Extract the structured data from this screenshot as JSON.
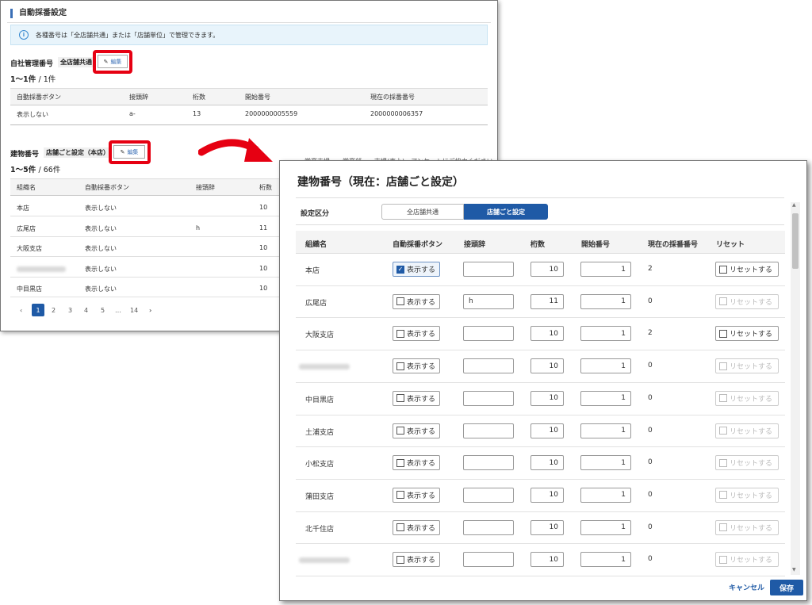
{
  "background": {
    "section_title": "自動採番設定",
    "info_text": "各種番号は「全店舗共通」または「店舗単位」で管理できます。",
    "own_number": {
      "label": "自社管理番号",
      "tag": "全店舗共通",
      "edit_label": "編集",
      "count": "1〜1件",
      "count_total": "/ 1件",
      "headers": [
        "自動採番ボタン",
        "接頭辞",
        "桁数",
        "開始番号",
        "現在の採番番号"
      ],
      "row": [
        "表示しない",
        "a-",
        "13",
        "2000000005559",
        "2000000006357"
      ]
    },
    "building_number": {
      "label": "建物番号",
      "tag": "店舗ごと設定（本店）",
      "edit_label": "編集",
      "count": "1〜5件",
      "count_total": "/ 66件",
      "headers": [
        "組織名",
        "自動採番ボタン",
        "接頭辞",
        "桁数"
      ],
      "rows": [
        {
          "org": "本店",
          "btn": "表示しない",
          "prefix": "",
          "digits": "10"
        },
        {
          "org": "広尾店",
          "btn": "表示しない",
          "prefix": "h",
          "digits": "11"
        },
        {
          "org": "大阪支店",
          "btn": "表示しない",
          "prefix": "",
          "digits": "10"
        },
        {
          "org": "",
          "btn": "表示しない",
          "prefix": "",
          "digits": "10"
        },
        {
          "org": "中目黒店",
          "btn": "表示しない",
          "prefix": "",
          "digits": "10"
        }
      ]
    },
    "pagination": {
      "prev": "‹",
      "pages": [
        "1",
        "2",
        "3",
        "4",
        "5",
        "…",
        "14"
      ],
      "next": "›",
      "active": "1"
    }
  },
  "behind_modal_bar": "営業支援　　営業部　　市場(売上)　アンケートにご協力ください",
  "modal": {
    "title": "建物番号（現在：店舗ごと設定）",
    "setting_label": "設定区分",
    "seg_common": "全店舗共通",
    "seg_per_store": "店舗ごと設定",
    "headers": {
      "org": "組織名",
      "auto_btn": "自動採番ボタン",
      "prefix": "接頭辞",
      "digits": "桁数",
      "start": "開始番号",
      "current": "現在の採番番号",
      "reset": "リセット"
    },
    "show_label": "表示する",
    "reset_label": "リセットする",
    "rows": [
      {
        "org": "本店",
        "checked": true,
        "prefix": "",
        "digits": "10",
        "start": "1",
        "current": "2",
        "reset_enabled": true
      },
      {
        "org": "広尾店",
        "checked": false,
        "prefix": "h",
        "digits": "11",
        "start": "1",
        "current": "0",
        "reset_enabled": false
      },
      {
        "org": "大阪支店",
        "checked": false,
        "prefix": "",
        "digits": "10",
        "start": "1",
        "current": "2",
        "reset_enabled": true
      },
      {
        "org": "",
        "checked": false,
        "prefix": "",
        "digits": "10",
        "start": "1",
        "current": "0",
        "reset_enabled": false
      },
      {
        "org": "中目黒店",
        "checked": false,
        "prefix": "",
        "digits": "10",
        "start": "1",
        "current": "0",
        "reset_enabled": false
      },
      {
        "org": "土浦支店",
        "checked": false,
        "prefix": "",
        "digits": "10",
        "start": "1",
        "current": "0",
        "reset_enabled": false
      },
      {
        "org": "小松支店",
        "checked": false,
        "prefix": "",
        "digits": "10",
        "start": "1",
        "current": "0",
        "reset_enabled": false
      },
      {
        "org": "蒲田支店",
        "checked": false,
        "prefix": "",
        "digits": "10",
        "start": "1",
        "current": "0",
        "reset_enabled": false
      },
      {
        "org": "北千住店",
        "checked": false,
        "prefix": "",
        "digits": "10",
        "start": "1",
        "current": "0",
        "reset_enabled": false
      },
      {
        "org": "",
        "checked": false,
        "prefix": "",
        "digits": "10",
        "start": "1",
        "current": "0",
        "reset_enabled": false
      }
    ],
    "cancel_label": "キャンセル",
    "save_label": "保存"
  },
  "colors": {
    "accent": "#1f5aa6",
    "highlight": "#e60012",
    "info_bg": "#e8f4fb"
  }
}
